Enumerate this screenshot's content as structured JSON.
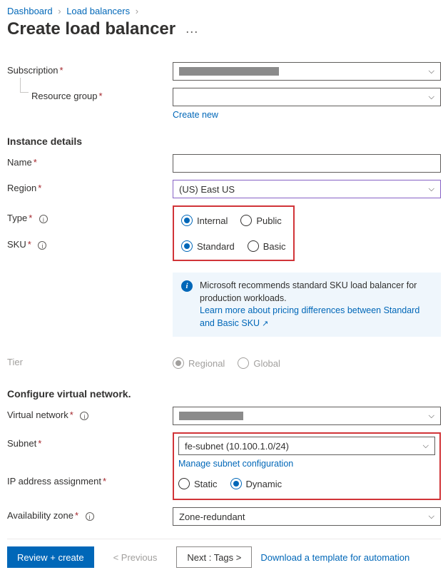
{
  "breadcrumb": {
    "items": [
      "Dashboard",
      "Load balancers"
    ],
    "sep": "›"
  },
  "title": "Create load balancer",
  "labels": {
    "subscription": "Subscription",
    "resource_group": "Resource group",
    "create_new": "Create new",
    "instance_details": "Instance details",
    "name": "Name",
    "region": "Region",
    "type": "Type",
    "sku": "SKU",
    "tier": "Tier",
    "configure_vn": "Configure virtual network.",
    "virtual_network": "Virtual network",
    "subnet": "Subnet",
    "manage_subnet": "Manage subnet configuration",
    "ip_assign": "IP address assignment",
    "avail_zone": "Availability zone"
  },
  "values": {
    "region": "(US) East US",
    "subnet": "fe-subnet (10.100.1.0/24)",
    "avail_zone": "Zone-redundant"
  },
  "radios": {
    "type_internal": "Internal",
    "type_public": "Public",
    "sku_standard": "Standard",
    "sku_basic": "Basic",
    "tier_regional": "Regional",
    "tier_global": "Global",
    "ip_static": "Static",
    "ip_dynamic": "Dynamic"
  },
  "banner": {
    "text": "Microsoft recommends standard SKU load balancer for production workloads.",
    "link": "Learn more about pricing differences between Standard and Basic SKU"
  },
  "footer": {
    "review": "Review + create",
    "prev": "< Previous",
    "next": "Next : Tags >",
    "download": "Download a template for automation"
  }
}
